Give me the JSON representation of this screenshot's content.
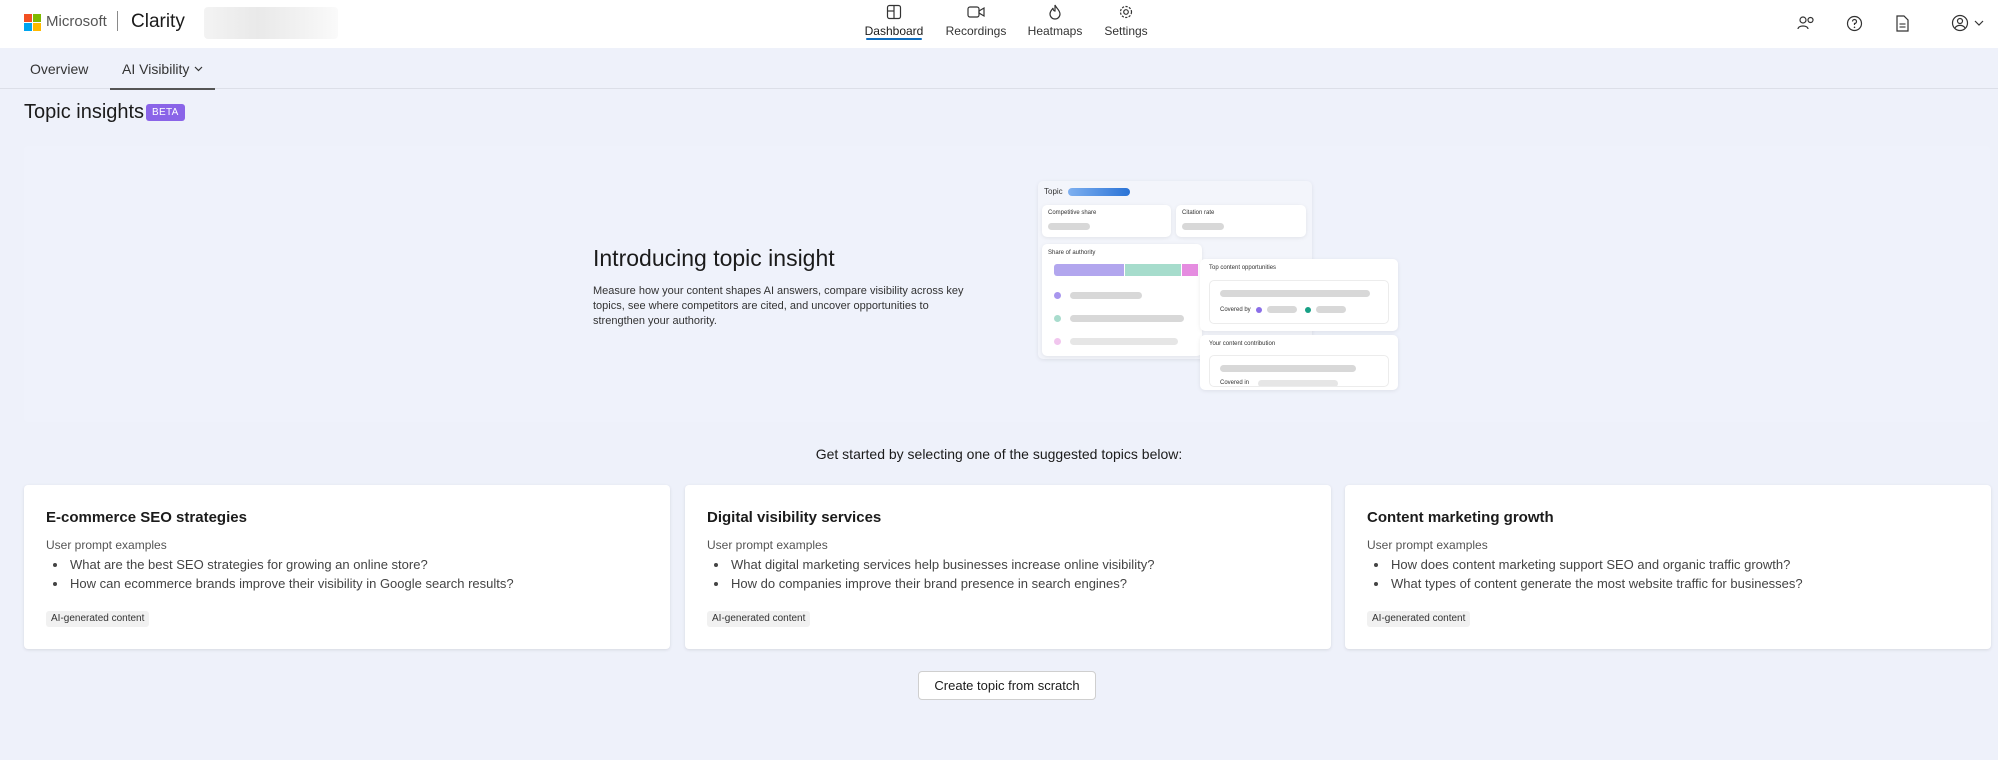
{
  "brand": {
    "company": "Microsoft",
    "product": "Clarity"
  },
  "nav": [
    {
      "label": "Dashboard",
      "icon": "dashboard-icon",
      "active": true
    },
    {
      "label": "Recordings",
      "icon": "video-icon",
      "active": false
    },
    {
      "label": "Heatmaps",
      "icon": "flame-icon",
      "active": false
    },
    {
      "label": "Settings",
      "icon": "gear-icon",
      "active": false
    }
  ],
  "utility_icons": [
    "people-settings-icon",
    "help-icon",
    "document-icon",
    "account-icon"
  ],
  "subtabs": {
    "overview": "Overview",
    "ai_visibility": "AI Visibility"
  },
  "page": {
    "title": "Topic insights",
    "badge": "BETA"
  },
  "hero": {
    "title": "Introducing topic insight",
    "description": "Measure how your content shapes AI answers, compare visibility across key topics, see where competitors are cited, and uncover opportunities to strengthen your authority.",
    "illustration": {
      "topic": "Topic",
      "competitive_share": "Competitive share",
      "citation_rate": "Citation rate",
      "share_of_authority": "Share of authority",
      "top_content_opportunities": "Top content opportunities",
      "covered_by": "Covered by",
      "your_content_contribution": "Your content contribution",
      "covered_in": "Covered in"
    }
  },
  "suggest": {
    "intro": "Get started by selecting one of the suggested topics below:",
    "cards": [
      {
        "title": "E-commerce SEO strategies",
        "subtitle": "User prompt examples",
        "prompts": [
          "What are the best SEO strategies for growing an online store?",
          "How can ecommerce brands improve their visibility in Google search results?"
        ],
        "badge": "AI-generated content"
      },
      {
        "title": "Digital visibility services",
        "subtitle": "User prompt examples",
        "prompts": [
          "What digital marketing services help businesses increase online visibility?",
          "How do companies improve their brand presence in search engines?"
        ],
        "badge": "AI-generated content"
      },
      {
        "title": "Content marketing growth",
        "subtitle": "User prompt examples",
        "prompts": [
          "How does content marketing support SEO and organic traffic growth?",
          "What types of content generate the most website traffic for businesses?"
        ],
        "badge": "AI-generated content"
      }
    ],
    "create_button": "Create topic from scratch"
  },
  "colors": {
    "accent": "#0f6cbd",
    "beta": "#8a64e8",
    "background": "#eef1fa"
  }
}
